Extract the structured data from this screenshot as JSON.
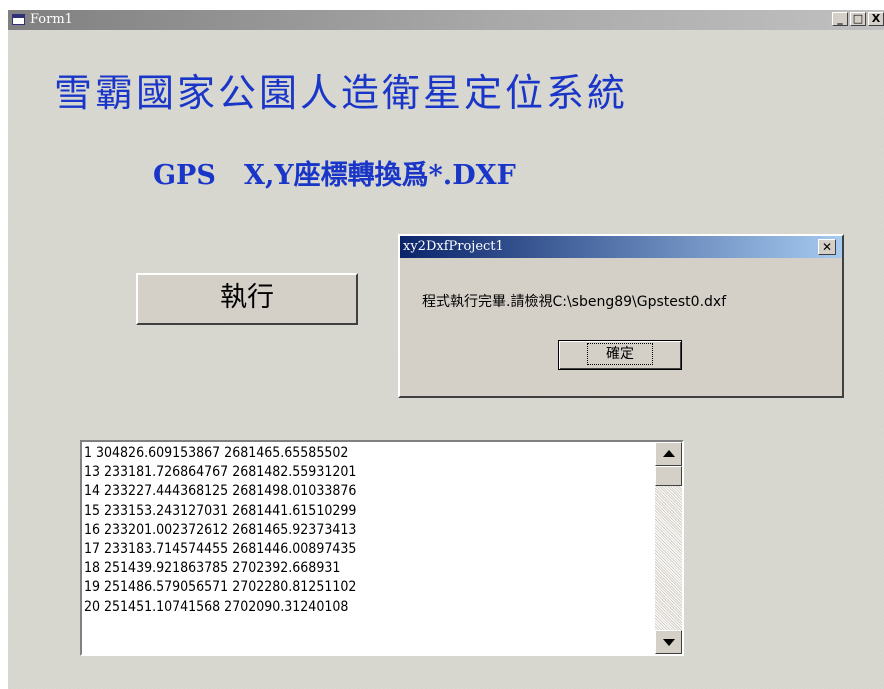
{
  "window": {
    "title": "Form1",
    "minimize_glyph": "_",
    "maximize_glyph": "□",
    "close_glyph": "X"
  },
  "heading": {
    "line1": "雪霸國家公園人造衛星定位系統",
    "line2": "GPS   X,Y座標轉換爲*.DXF"
  },
  "run_button": {
    "label": "執行"
  },
  "dialog": {
    "title": "xy2DxfProject1",
    "close_glyph": "✕",
    "message": "程式執行完畢.請檢視C:\\sbeng89\\Gpstest0.dxf",
    "ok_label": "確定"
  },
  "listbox": {
    "items": [
      "1 304826.609153867 2681465.65585502",
      "13 233181.726864767 2681482.55931201",
      "14 233227.444368125 2681498.01033876",
      "15 233153.243127031 2681441.61510299",
      "16 233201.002372612 2681465.92373413",
      "17 233183.714574455 2681446.00897435",
      "18 251439.921863785 2702392.668931",
      "19 251486.579056571 2702280.81251102",
      "20 251451.10741568 2702090.31240108"
    ]
  },
  "icons": {
    "window_icon": "form-window-icon",
    "scroll_up": "scroll-up-arrow-icon",
    "scroll_down": "scroll-down-arrow-icon"
  }
}
